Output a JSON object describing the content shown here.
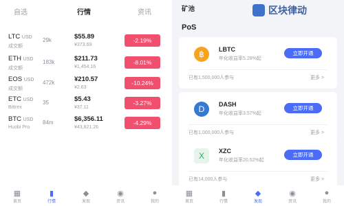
{
  "left": {
    "tabs": [
      "自选",
      "行情",
      "资讯"
    ],
    "rows": [
      {
        "symbol": "LTC",
        "pair": "USD",
        "volume": "成交额",
        "change": "29k",
        "price": "$55.89",
        "sub": "¥373.69",
        "badge": "-2.19%"
      },
      {
        "symbol": "ETH",
        "pair": "USD",
        "volume": "成交额",
        "change": "183k",
        "price": "$211.73",
        "sub": "¥1,454.16",
        "badge": "-8.01%"
      },
      {
        "symbol": "EOS",
        "pair": "USD",
        "volume": "成交额",
        "change": "472k",
        "price": "¥210.57",
        "sub": "¥2.63",
        "badge": "-10.24%"
      },
      {
        "symbol": "ETC",
        "pair": "USD",
        "volume": "Bittrex",
        "change": "35",
        "price": "$5.43",
        "sub": "¥37.11",
        "badge": "-3.27%"
      },
      {
        "symbol": "BTC",
        "pair": "USD",
        "volume": "Huobi Pro",
        "change": "84m",
        "price": "$6,356.11",
        "sub": "¥43,821.26",
        "badge": "-4.29%"
      }
    ],
    "nav": [
      {
        "label": "首页",
        "icon": "▦",
        "active": false
      },
      {
        "label": "行情",
        "icon": "▮",
        "active": true
      },
      {
        "label": "发现",
        "icon": "◆",
        "active": false
      },
      {
        "label": "资讯",
        "icon": "◉",
        "active": false
      },
      {
        "label": "我的",
        "icon": "●",
        "active": false
      }
    ]
  },
  "right": {
    "top_title": "矿池",
    "logo_text": "区块律动",
    "section": "PoS",
    "cards": [
      {
        "coin_icon": "฿",
        "name": "LBTC",
        "rate": "年化收益率5.28%起",
        "button": "立即开通",
        "footer": "已有1,500,000人参与",
        "more": "更多 >"
      },
      {
        "coin_icon": "D",
        "name": "DASH",
        "rate": "年化收益率3.57%起",
        "button": "立即开通",
        "footer": "已有1,000,000人参与",
        "more": "更多 >"
      },
      {
        "coin_icon": "X",
        "name": "XZC",
        "rate": "年化收益率20.52%起",
        "button": "立即开通",
        "footer": "已有14,000人参与",
        "more": "更多 >"
      }
    ],
    "nav": [
      {
        "label": "首页",
        "icon": "▦",
        "active": false
      },
      {
        "label": "行情",
        "icon": "▮",
        "active": false
      },
      {
        "label": "发现",
        "icon": "◆",
        "active": true
      },
      {
        "label": "资讯",
        "icon": "◉",
        "active": false
      },
      {
        "label": "我的",
        "icon": "●",
        "active": false
      }
    ]
  },
  "colors": {
    "accent": "#4a6cf7",
    "down": "#f0506e"
  }
}
